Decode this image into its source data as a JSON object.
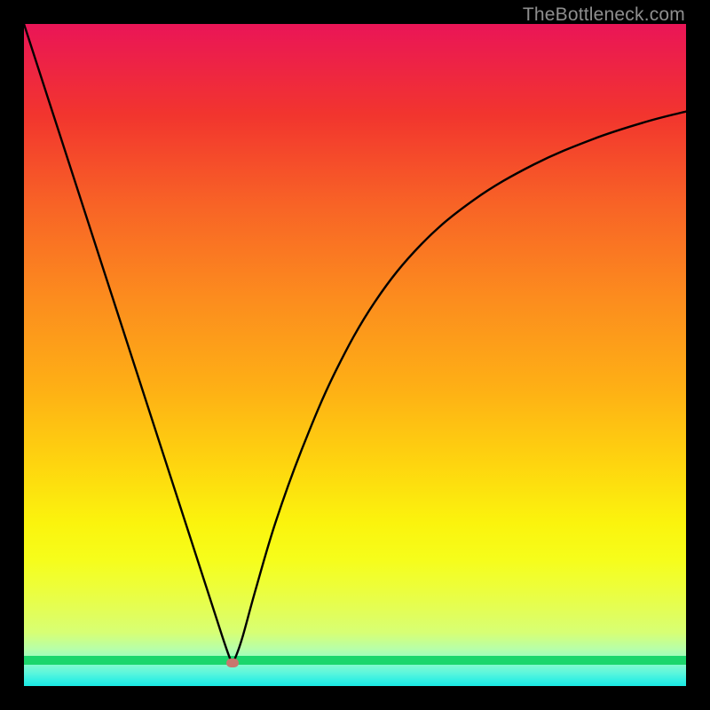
{
  "watermark": "TheBottleneck.com",
  "colors": {
    "background": "#000000",
    "curve": "#000000",
    "marker": "#c9766e",
    "green_band": "#1bd66c"
  },
  "chart_data": {
    "type": "line",
    "title": "",
    "xlabel": "",
    "ylabel": "",
    "xlim": [
      0,
      100
    ],
    "ylim": [
      0,
      100
    ],
    "series": [
      {
        "name": "bottleneck-curve",
        "x": [
          0,
          5,
          10,
          15,
          20,
          25,
          28,
          30,
          31,
          31.5,
          32,
          33,
          35,
          38,
          42,
          47,
          53,
          60,
          68,
          77,
          86,
          94,
          100
        ],
        "y": [
          100,
          84,
          68,
          52,
          36,
          20,
          10.4,
          4,
          1,
          0,
          1,
          4,
          11.5,
          22,
          33.5,
          45.5,
          56.5,
          65.5,
          72.5,
          78,
          82,
          84.7,
          86.3
        ]
      }
    ],
    "annotations": [
      {
        "name": "min-marker",
        "x": 31.5,
        "y": 0
      }
    ],
    "gradient_stops_main": [
      {
        "pos": 0,
        "color": "#ea1557"
      },
      {
        "pos": 15,
        "color": "#f2352e"
      },
      {
        "pos": 30,
        "color": "#f86426"
      },
      {
        "pos": 45,
        "color": "#fc8c1e"
      },
      {
        "pos": 60,
        "color": "#feb015"
      },
      {
        "pos": 72,
        "color": "#fed40f"
      },
      {
        "pos": 82,
        "color": "#fbf40d"
      },
      {
        "pos": 88,
        "color": "#f6fd1b"
      },
      {
        "pos": 92,
        "color": "#eefe36"
      },
      {
        "pos": 96,
        "color": "#e4fe54"
      },
      {
        "pos": 100,
        "color": "#d7ff75"
      }
    ],
    "gradient_stops_bottom": [
      {
        "pos": 0,
        "color": "#d7ff75"
      },
      {
        "pos": 30,
        "color": "#b7ffa8"
      },
      {
        "pos": 55,
        "color": "#8dfcc9"
      },
      {
        "pos": 75,
        "color": "#5df6dc"
      },
      {
        "pos": 88,
        "color": "#36f0e2"
      },
      {
        "pos": 100,
        "color": "#1ae9e3"
      }
    ]
  }
}
